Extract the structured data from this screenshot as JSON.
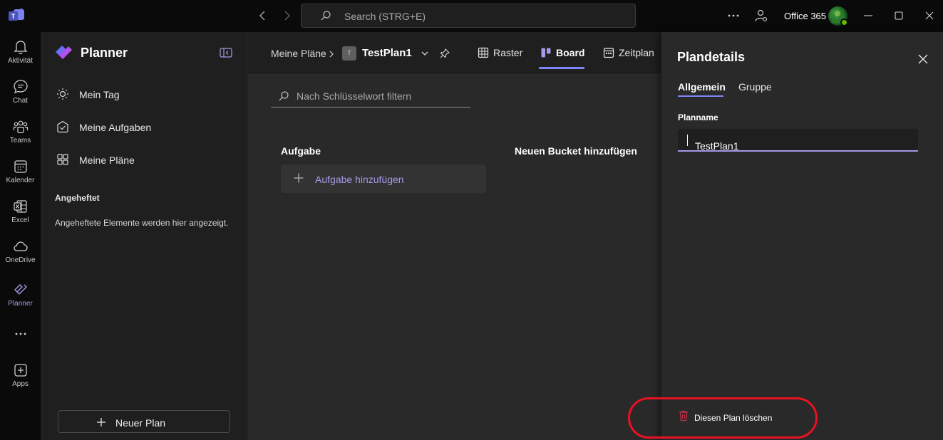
{
  "titlebar": {
    "search_placeholder": "Search (STRG+E)",
    "org_name": "Office 365",
    "colors": {
      "accent": "#7f85f5",
      "link": "#a49ae6",
      "danger": "#e81224"
    }
  },
  "rail": {
    "items": [
      {
        "label": "Aktivität",
        "icon": "bell-icon"
      },
      {
        "label": "Chat",
        "icon": "chat-icon"
      },
      {
        "label": "Teams",
        "icon": "teams-icon"
      },
      {
        "label": "Kalender",
        "icon": "calendar-icon"
      },
      {
        "label": "Excel",
        "icon": "excel-icon"
      },
      {
        "label": "OneDrive",
        "icon": "cloud-icon"
      },
      {
        "label": "Planner",
        "icon": "planner-icon"
      },
      {
        "label": "Apps",
        "icon": "add-icon"
      }
    ]
  },
  "leftpane": {
    "title": "Planner",
    "nav": [
      {
        "label": "Mein Tag",
        "icon": "sun-icon"
      },
      {
        "label": "Meine Aufgaben",
        "icon": "task-icon"
      },
      {
        "label": "Meine Pläne",
        "icon": "grid-icon"
      }
    ],
    "pinned_heading": "Angeheftet",
    "pinned_note": "Angeheftete Elemente werden hier angezeigt.",
    "new_plan_label": "Neuer Plan"
  },
  "main": {
    "breadcrumb_root": "Meine Pläne",
    "plan_badge": "T",
    "plan_name": "TestPlan1",
    "tabs": [
      {
        "label": "Raster",
        "icon": "table-icon"
      },
      {
        "label": "Board",
        "icon": "board-icon",
        "active": true
      },
      {
        "label": "Zeitplan",
        "icon": "calendar-icon"
      }
    ],
    "filter_placeholder": "Nach Schlüsselwort filtern",
    "bucket_title": "Aufgabe",
    "add_task_label": "Aufgabe hinzufügen",
    "add_bucket_label": "Neuen Bucket hinzufügen"
  },
  "details": {
    "title": "Plandetails",
    "tabs": [
      {
        "label": "Allgemein",
        "active": true
      },
      {
        "label": "Gruppe"
      }
    ],
    "plan_name_label": "Planname",
    "plan_name_value": "TestPlan1",
    "delete_label": "Diesen Plan löschen"
  }
}
